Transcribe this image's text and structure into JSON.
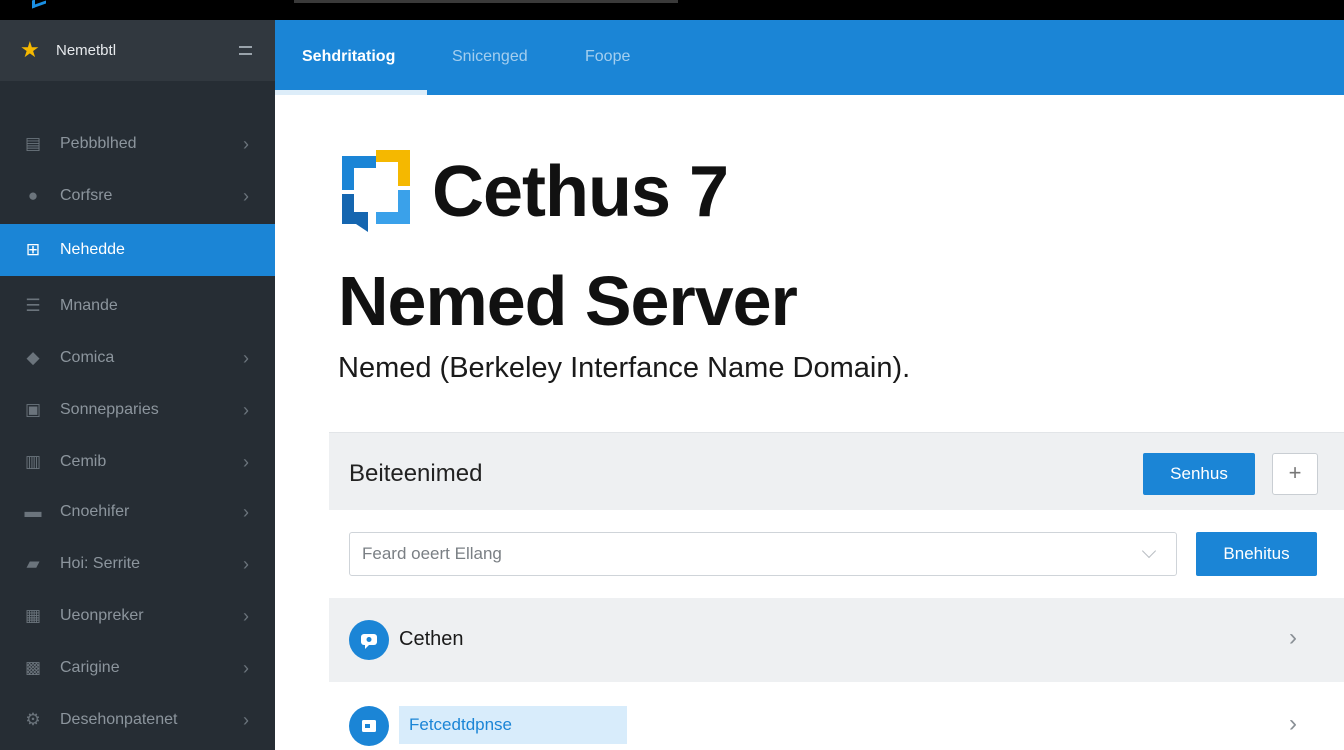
{
  "sidebar": {
    "header_title": "Nemetbtl",
    "items": [
      {
        "label": "Pebbblhed",
        "icon": "server-icon",
        "chevron": true,
        "active": false
      },
      {
        "label": "Corfsre",
        "icon": "user-icon",
        "chevron": true,
        "active": false
      },
      {
        "label": "Nehedde",
        "icon": "network-icon",
        "chevron": false,
        "active": true
      },
      {
        "label": "Mnande",
        "icon": "tray-icon",
        "chevron": false,
        "active": false
      },
      {
        "label": "Comica",
        "icon": "tag-icon",
        "chevron": true,
        "active": false
      },
      {
        "label": "Sonnepparies",
        "icon": "briefcase-icon",
        "chevron": true,
        "active": false
      },
      {
        "label": "Cemib",
        "icon": "folder-icon",
        "chevron": true,
        "active": false
      },
      {
        "label": "Cnoehifer",
        "icon": "display-icon",
        "chevron": true,
        "active": false
      },
      {
        "label": "Hoi: Serrite",
        "icon": "file-icon",
        "chevron": true,
        "active": false
      },
      {
        "label": "Ueonpreker",
        "icon": "box-icon",
        "chevron": true,
        "active": false
      },
      {
        "label": "Carigine",
        "icon": "calendar-icon",
        "chevron": true,
        "active": false
      },
      {
        "label": "Desehonpatenet",
        "icon": "gear-icon",
        "chevron": true,
        "active": false
      }
    ]
  },
  "tabs": [
    {
      "label": "Sehdritatiog",
      "active": true
    },
    {
      "label": "Snicenged",
      "active": false
    },
    {
      "label": "Foope",
      "active": false
    }
  ],
  "main": {
    "app_title": "Cethus 7",
    "page_title": "Nemed Server",
    "subtitle": "Nemed (Berkeley Interfance Name Domain)."
  },
  "panel": {
    "title": "Beiteenimed",
    "primary_button": "Senhus",
    "plus_button": "+",
    "search_placeholder": "Feard oeert Ellang",
    "search_button": "Bnehitus",
    "rows": [
      {
        "label": "Cethen"
      },
      {
        "label": "Fetcedtdpnse"
      }
    ]
  },
  "colors": {
    "accent": "#1b85d6",
    "sidebar_bg": "#262d34",
    "sidebar_header_bg": "#31383f",
    "star": "#f5b800"
  }
}
